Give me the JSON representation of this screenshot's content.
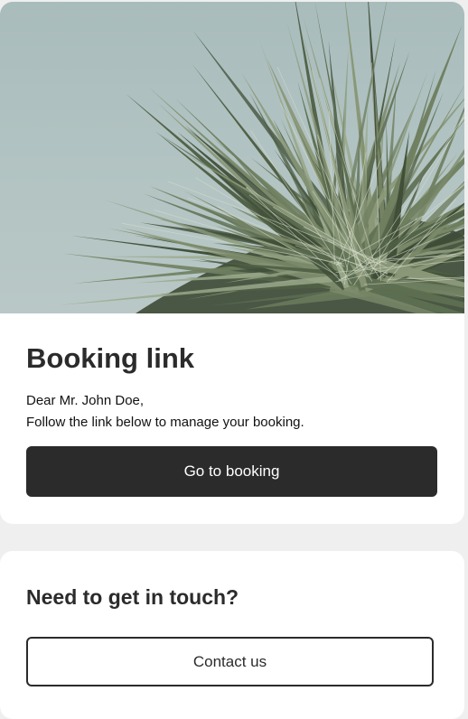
{
  "booking_card": {
    "hero_image": "palm-plant-photo",
    "title": "Booking link",
    "greeting": "Dear Mr. John Doe,",
    "instruction": "Follow the link below to manage your booking.",
    "cta_label": "Go to booking"
  },
  "contact_card": {
    "title": "Need to get in touch?",
    "cta_label": "Contact us"
  },
  "colors": {
    "page_background": "#efefef",
    "card_background": "#ffffff",
    "primary_button": "#2b2b2b",
    "primary_button_text": "#ffffff",
    "text": "#2b2b2b"
  }
}
